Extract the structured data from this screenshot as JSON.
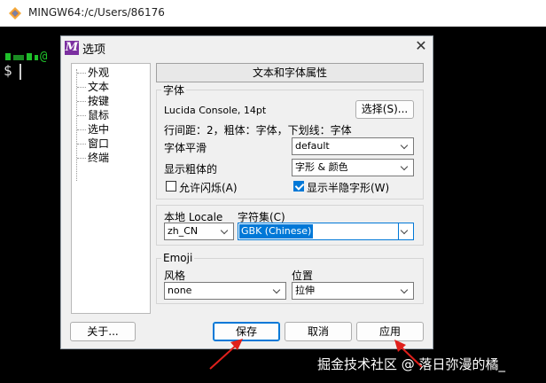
{
  "terminal": {
    "title": "MINGW64:/c/Users/86176",
    "prompt_tail": "@",
    "prompt_symbol": "$"
  },
  "dialog": {
    "title": "选项",
    "close_glyph": "✕",
    "tree": [
      "外观",
      "文本",
      "按键",
      "鼠标",
      "选中",
      "窗口",
      "终端"
    ],
    "section_header": "文本和字体属性",
    "font_group": {
      "label": "字体",
      "font_name": "Lucida Console, 14pt",
      "select_button": "选择(S)...",
      "details": "行间距：2，粗体：字体，下划线：字体",
      "smoothing_label": "字体平滑",
      "smoothing_value": "default",
      "bold_label": "显示粗体的",
      "bold_value": "字形 & 颜色",
      "blink_label": "允许闪烁(A)",
      "blink_checked": false,
      "hidden_label": "显示半隐字形(W)",
      "hidden_checked": true
    },
    "locale": {
      "locale_label": "本地 Locale",
      "locale_value": "zh_CN",
      "charset_label": "字符集(C)",
      "charset_value": "GBK (Chinese)"
    },
    "emoji_group": {
      "label": "Emoji",
      "style_label": "风格",
      "style_value": "none",
      "position_label": "位置",
      "position_value": "拉伸"
    },
    "buttons": {
      "about": "关于...",
      "save": "保存",
      "cancel": "取消",
      "apply": "应用"
    }
  },
  "watermark": "掘金技术社区 @ 落日弥漫的橘_",
  "colors": {
    "accent": "#0078d7",
    "annotation_arrow": "#e0201c",
    "app_icon": "#7b2fa0"
  }
}
